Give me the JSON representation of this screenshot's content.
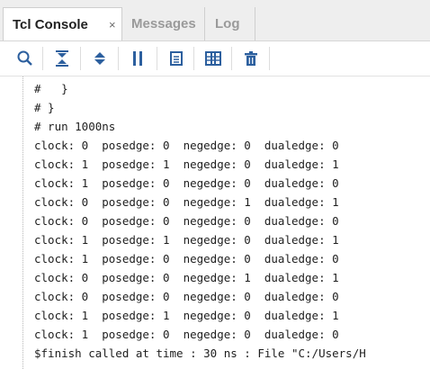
{
  "tabs": [
    {
      "label": "Tcl Console",
      "active": true,
      "close": "×"
    },
    {
      "label": "Messages"
    },
    {
      "label": "Log"
    }
  ],
  "toolbar": {
    "icons": [
      "search-icon",
      "collapse-all-icon",
      "expand-all-icon",
      "pause-icon",
      "copy-icon",
      "columns-icon",
      "trash-icon"
    ],
    "accent_color": "#2c5f9e"
  },
  "console": {
    "lines": [
      "#   }",
      "# }",
      "# run 1000ns",
      "clock: 0  posedge: 0  negedge: 0  dualedge: 0",
      "clock: 1  posedge: 1  negedge: 0  dualedge: 1",
      "clock: 1  posedge: 0  negedge: 0  dualedge: 0",
      "clock: 0  posedge: 0  negedge: 1  dualedge: 1",
      "clock: 0  posedge: 0  negedge: 0  dualedge: 0",
      "clock: 1  posedge: 1  negedge: 0  dualedge: 1",
      "clock: 1  posedge: 0  negedge: 0  dualedge: 0",
      "clock: 0  posedge: 0  negedge: 1  dualedge: 1",
      "clock: 0  posedge: 0  negedge: 0  dualedge: 0",
      "clock: 1  posedge: 1  negedge: 0  dualedge: 1",
      "clock: 1  posedge: 0  negedge: 0  dualedge: 0",
      "$finish called at time : 30 ns : File \"C:/Users/H"
    ]
  }
}
